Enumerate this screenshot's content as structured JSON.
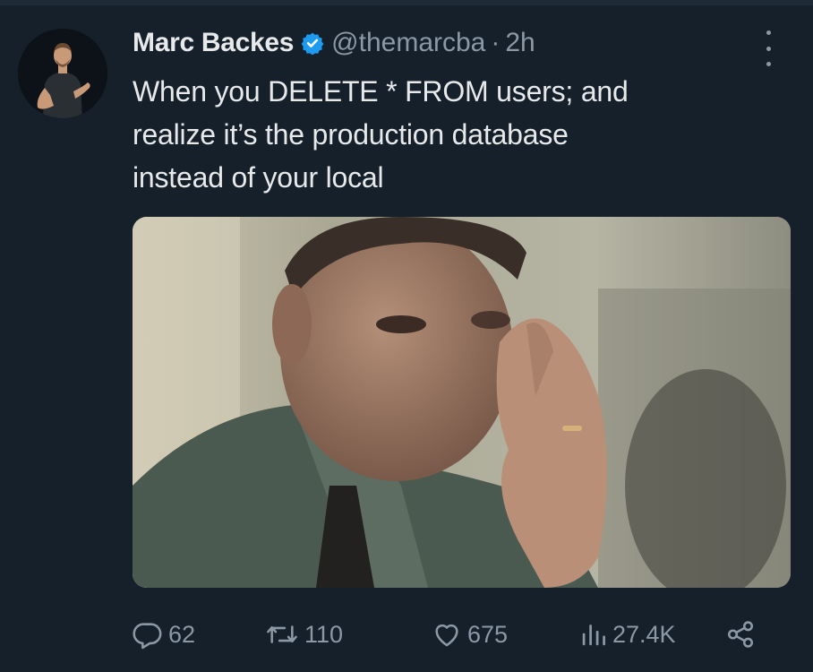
{
  "author": {
    "name": "Marc Backes",
    "handle": "@themarcba",
    "separator": "·",
    "time": "2h",
    "verified": true
  },
  "tweet": {
    "text_lines": [
      "When you DELETE * FROM users; and",
      "realize it’s the production database",
      "instead of your local"
    ]
  },
  "metrics": {
    "replies": "62",
    "retweets": "110",
    "likes": "675",
    "views": "27.4K"
  },
  "icons": {
    "more": "more-vertical-icon",
    "reply": "reply-bubble-icon",
    "retweet": "retweet-icon",
    "like": "heart-icon",
    "views": "bar-chart-icon",
    "share": "share-icon",
    "verified": "verified-badge-icon"
  },
  "colors": {
    "background": "#15202b",
    "primary_text": "#e7e9ea",
    "secondary_text": "#8b98a5",
    "verified": "#1d9bf0"
  }
}
